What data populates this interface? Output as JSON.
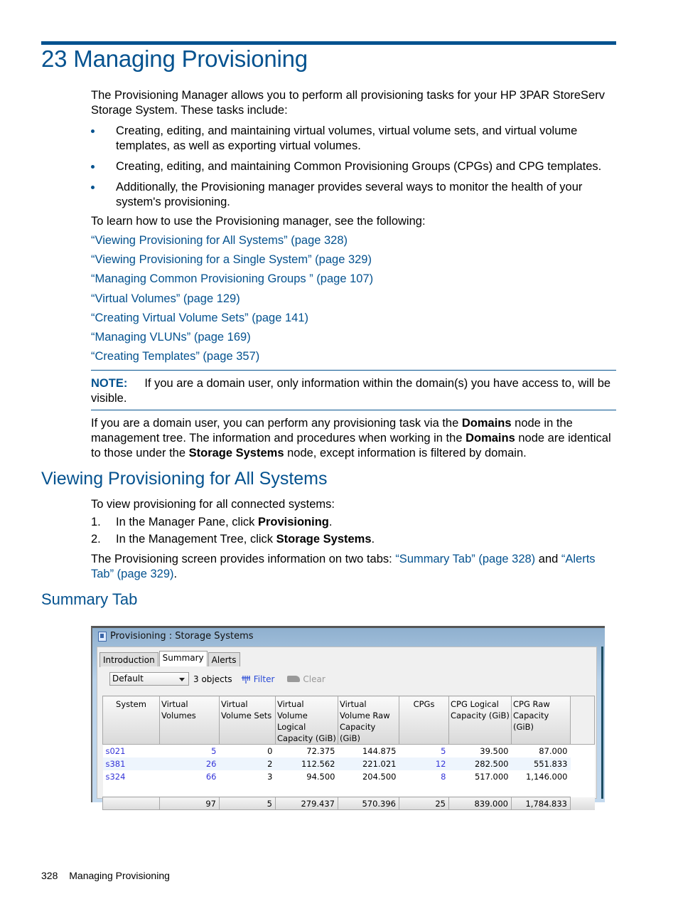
{
  "chapter": {
    "title": "23 Managing Provisioning",
    "intro": "The Provisioning Manager allows you to perform all provisioning tasks for your HP 3PAR StoreServ Storage System. These tasks include:",
    "bullets": [
      "Creating, editing, and maintaining virtual volumes, virtual volume sets, and virtual volume templates, as well as exporting virtual volumes.",
      "Creating, editing, and maintaining Common Provisioning Groups (CPGs) and CPG templates.",
      "Additionally, the Provisioning manager provides several ways to monitor the health of your system's provisioning."
    ],
    "learn_text": "To learn how to use the Provisioning manager, see the following:",
    "links": [
      "“Viewing Provisioning for All Systems” (page 328)",
      "“Viewing Provisioning for a Single System” (page 329)",
      "“Managing Common Provisioning Groups ” (page 107)",
      "“Virtual Volumes” (page 129)",
      "“Creating Virtual Volume Sets” (page 141)",
      "“Managing VLUNs” (page 169)",
      "“Creating Templates” (page 357)"
    ],
    "note": {
      "label": "NOTE:",
      "text": "If you are a domain user, only information within the domain(s) you have access to, will be visible."
    },
    "domain_para": {
      "t1": "If you are a domain user, you can perform any provisioning task via the ",
      "b1": "Domains",
      "t2": " node in the management tree. The information and procedures when working in the ",
      "b2": "Domains",
      "t3": " node are identical to those under the ",
      "b3": "Storage Systems",
      "t4": " node, except information is filtered by domain."
    }
  },
  "section": {
    "title": "Viewing Provisioning for All Systems",
    "intro": "To view provisioning for all connected systems:",
    "steps": [
      {
        "num": "1.",
        "text": "In the Manager Pane, click ",
        "bold": "Provisioning",
        "end": "."
      },
      {
        "num": "2.",
        "text": "In the Management Tree, click ",
        "bold": "Storage Systems",
        "end": "."
      }
    ],
    "tabs_para": {
      "t1": "The Provisioning screen provides information on two tabs: ",
      "link1": "“Summary Tab” (page 328)",
      "t2": " and ",
      "link2": "“Alerts Tab” (page 329)",
      "t3": "."
    }
  },
  "subsection": {
    "title": "Summary Tab"
  },
  "screenshot": {
    "window_title": "Provisioning : Storage Systems",
    "tabs": [
      "Introduction",
      "Summary",
      "Alerts"
    ],
    "active_tab": "Summary",
    "filter_select": "Default",
    "object_count": "3 objects",
    "filter_label": "Filter",
    "clear_label": "Clear",
    "columns": [
      "System",
      "Virtual Volumes",
      "Virtual Volume Sets",
      "Virtual Volume Logical Capacity (GiB)",
      "Virtual Volume Raw Capacity (GiB)",
      "CPGs",
      "CPG Logical Capacity (GiB)",
      "CPG Raw Capacity (GiB)"
    ],
    "rows": [
      [
        "s021",
        "5",
        "0",
        "72.375",
        "144.875",
        "5",
        "39.500",
        "87.000"
      ],
      [
        "s381",
        "26",
        "2",
        "112.562",
        "221.021",
        "12",
        "282.500",
        "551.833"
      ],
      [
        "s324",
        "66",
        "3",
        "94.500",
        "204.500",
        "8",
        "517.000",
        "1,146.000"
      ]
    ],
    "totals": [
      "",
      "97",
      "5",
      "279.437",
      "570.396",
      "25",
      "839.000",
      "1,784.833"
    ]
  },
  "footer": {
    "page_number": "328",
    "running_title": "Managing Provisioning"
  }
}
